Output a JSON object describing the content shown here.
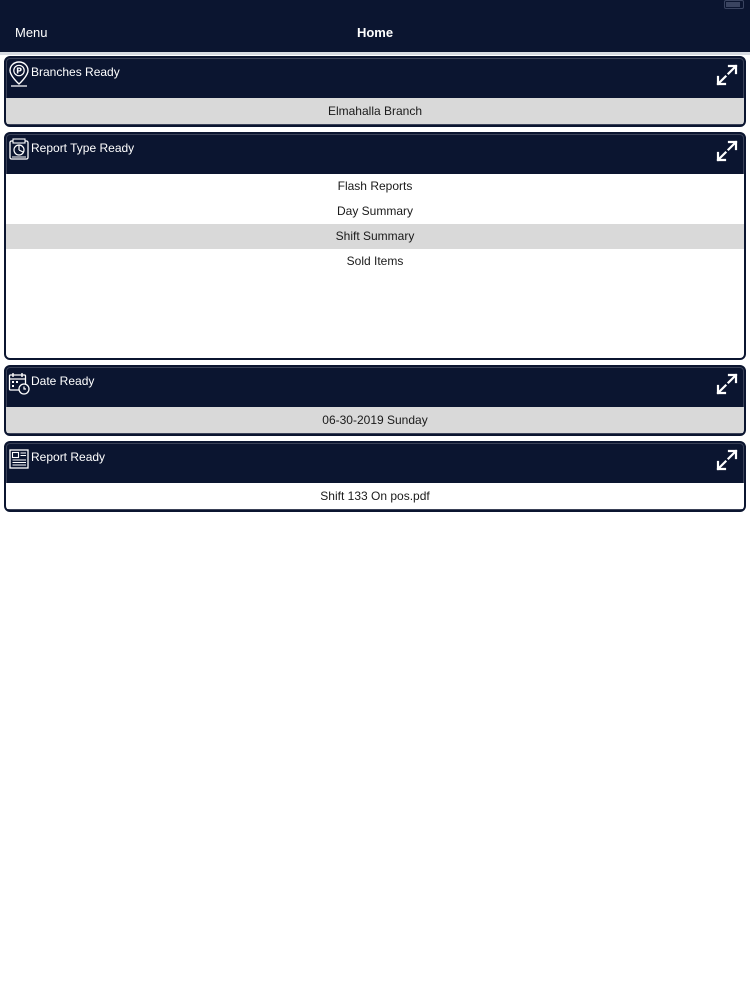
{
  "nav": {
    "menu_label": "Menu",
    "title": "Home"
  },
  "panels": {
    "branches": {
      "title": "Branches  Ready",
      "icon": "map-pin-icon",
      "value": "Elmahalla Branch"
    },
    "report_type": {
      "title": "Report Type  Ready",
      "icon": "report-document-icon",
      "options": [
        "Flash Reports",
        "Day Summary",
        "Shift Summary",
        "Sold Items"
      ],
      "selected": "Shift Summary"
    },
    "date": {
      "title": "Date  Ready",
      "icon": "calendar-clock-icon",
      "value": "06-30-2019 Sunday"
    },
    "report": {
      "title": "Report  Ready",
      "icon": "newspaper-icon",
      "value": "Shift 133 On pos.pdf"
    }
  },
  "colors": {
    "header_bg": "#0b1530",
    "selected_row": "#d9d9d9",
    "page_bg": "#ffffff"
  }
}
